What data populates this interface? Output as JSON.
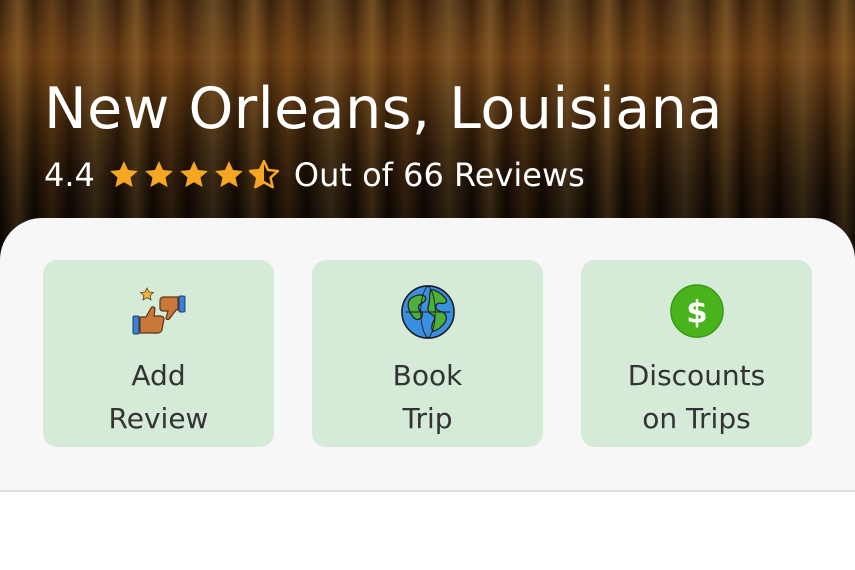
{
  "location": {
    "title": "New Orleans, Louisiana",
    "rating": "4.4",
    "rating_value": 4.4,
    "rating_max": 5,
    "reviews_text": "Out of 66 Reviews"
  },
  "actions": [
    {
      "label": "Add\nReview",
      "icon": "thumbs-up-down-icon"
    },
    {
      "label": "Book\nTrip",
      "icon": "globe-icon"
    },
    {
      "label": "Discounts\non Trips",
      "icon": "dollar-coin-icon"
    }
  ],
  "colors": {
    "star": "#f5a623",
    "card_bg": "#d5ead7",
    "panel_bg": "#f7f7f7",
    "dollar_green": "#49b31b"
  }
}
